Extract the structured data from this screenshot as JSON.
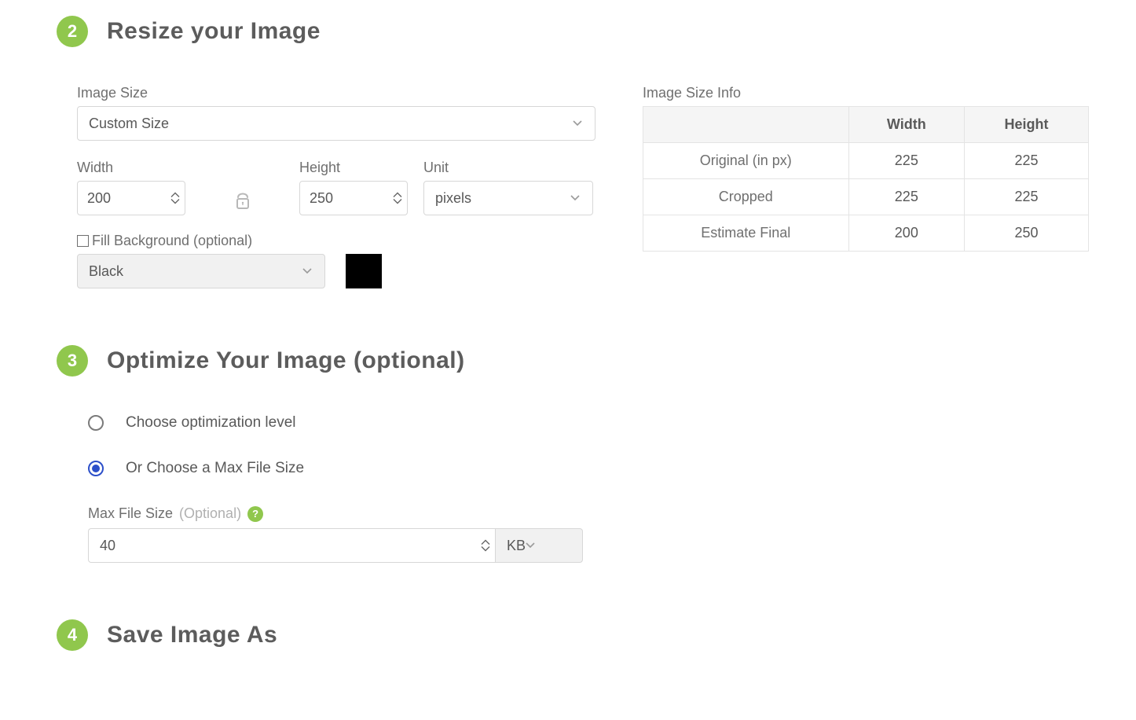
{
  "section2": {
    "badge": "2",
    "title": "Resize your Image",
    "imageSizeLabel": "Image Size",
    "imageSizeValue": "Custom Size",
    "widthLabel": "Width",
    "widthValue": "200",
    "heightLabel": "Height",
    "heightValue": "250",
    "unitLabel": "Unit",
    "unitValue": "pixels",
    "fillLabel": "Fill Background (optional)",
    "fillColorValue": "Black",
    "swatchColor": "#000000"
  },
  "infoTable": {
    "label": "Image Size Info",
    "headers": {
      "col1": "",
      "col2": "Width",
      "col3": "Height"
    },
    "rows": [
      {
        "name": "Original (in px)",
        "w": "225",
        "h": "225"
      },
      {
        "name": "Cropped",
        "w": "225",
        "h": "225"
      },
      {
        "name": "Estimate Final",
        "w": "200",
        "h": "250"
      }
    ]
  },
  "section3": {
    "badge": "3",
    "title": "Optimize Your Image (optional)",
    "radio1": "Choose optimization level",
    "radio2": "Or Choose a Max File Size",
    "maxFileLabel": "Max File Size",
    "maxFileOptional": "(Optional)",
    "maxFileValue": "40",
    "maxFileUnit": "KB",
    "help": "?"
  },
  "section4": {
    "badge": "4",
    "title": "Save Image As"
  }
}
